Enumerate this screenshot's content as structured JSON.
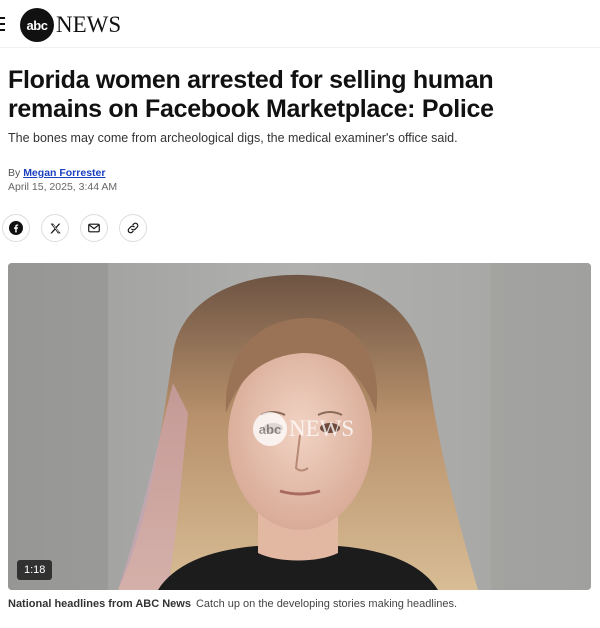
{
  "header": {
    "logo_circle_text": "abc",
    "logo_word": "NEWS"
  },
  "article": {
    "headline": "Florida women arrested for selling human remains on Facebook Marketplace: Police",
    "dek": "The bones may come from archeological digs, the medical examiner's office said.",
    "byline_prefix": "By",
    "author": "Megan Forrester",
    "timestamp": "April 15, 2025, 3:44 AM"
  },
  "share": {
    "icons": [
      "facebook-icon",
      "x-icon",
      "mail-icon",
      "link-icon"
    ]
  },
  "video": {
    "watermark_circle": "abc",
    "watermark_word": "NEWS",
    "duration": "1:18"
  },
  "caption": {
    "label": "National headlines from ABC News",
    "text": "Catch up on the developing stories making headlines."
  },
  "colors": {
    "link": "#1a3fbf",
    "text": "#111111"
  }
}
